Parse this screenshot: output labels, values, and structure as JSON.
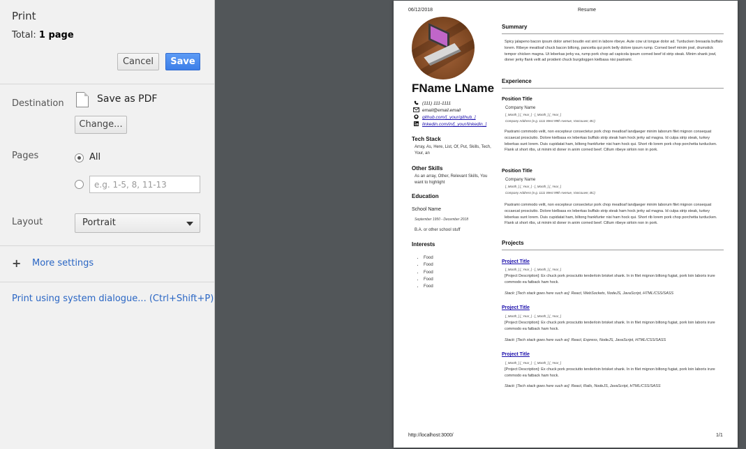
{
  "panel": {
    "title": "Print",
    "total_label": "Total:",
    "total_value": "1 page",
    "cancel": "Cancel",
    "save": "Save",
    "destination_label": "Destination",
    "destination_value": "Save as PDF",
    "change": "Change...",
    "pages_label": "Pages",
    "pages_all": "All",
    "pages_range_placeholder": "e.g. 1-5, 8, 11-13",
    "layout_label": "Layout",
    "layout_value": "Portrait",
    "more_settings": "More settings",
    "system_dialog": "Print using system dialogue... (Ctrl+Shift+P)"
  },
  "page": {
    "date": "06/12/2018",
    "header_title": "Resume",
    "footer_url": "http://localhost:3000/",
    "footer_page": "1/1",
    "name": "FName LName",
    "phone": "(111) 111-1111",
    "email": "email@email.email",
    "github": "github.com/[_your/github_]",
    "linkedin": "linkedin.com/in/[_your/linkedin_]",
    "tech_stack_h": "Tech Stack",
    "tech_stack": "Array, As, Here, List, Of, Put, Skills, Tech, Your, an",
    "other_skills_h": "Other Skills",
    "other_skills": "As an array, Other, Relevant Skills, You want to highlight",
    "education_h": "Education",
    "school": "School Name",
    "edu_dates": "September 1950 - December 2018",
    "degree": "B.A. or other school stuff",
    "interests_h": "Interests",
    "interests": [
      "Food",
      "Food",
      "Food",
      "Food",
      "Food"
    ],
    "summary_h": "Summary",
    "summary": "Spicy jalapeno bacon ipsum dolor amet boudin est sint in labore ribeye. Aute cow ut tongue dolor ad. Turducken bresaola buffalo lorem. Ribeye meatloaf chuck bacon biltong, pancetta qui pork belly dolore ipsum rump. Corned beef minim jowl, drumstick tempor chicken magna. Ut leberkas jerky ea, rump pork chop ad capicola ipsum corned beef id strip steak. Minim shank jowl, doner jerky flank velit ad proident chuck burgdoggen kielbasa nisi pastrami.",
    "experience_h": "Experience",
    "jobs": [
      {
        "title": "Position Title",
        "company": "Company Name",
        "dates": "[_Month_] [_Year_] - [_Month_] [_Year_]",
        "address": "Company Address (e.g. 1111 West 99th Avenue, Vancouver, BC)",
        "desc": "Pastrami commodo velit, non excepteur consectetur pork chop meatloaf landjaeger minim laborum filet mignon consequat occaecat prosciutto. Dolore kielbasa ex leberkas buffalo strip steak ham hock jerky ad magna. Id culpa strip steak, turkey leberkas sunt lorem. Duis cupidatat ham, biltong frankfurter nisi ham hock qui. Short rib lorem pork chop porchetta turducken. Flank ut short ribs, ut minim id doner in anim corned beef. Cillum ribeye sirloin non in pork."
      },
      {
        "title": "Position Title",
        "company": "Company Name",
        "dates": "[_Month_] [_Year_] - [_Month_] [_Year_]",
        "address": "Company Address (e.g. 1111 West 99th Avenue, Vancouver, BC)",
        "desc": "Pastrami commodo velit, non excepteur consectetur pork chop meatloaf landjaeger minim laborum filet mignon consequat occaecat prosciutto. Dolore kielbasa ex leberkas buffalo strip steak ham hock jerky ad magna. Id culpa strip steak, turkey leberkas sunt lorem. Duis cupidatat ham, biltong frankfurter nisi ham hock qui. Short rib lorem pork chop porchetta turducken. Flank ut short ribs, ut minim id doner in anim corned beef. Cillum ribeye sirloin non in pork."
      }
    ],
    "projects_h": "Projects",
    "projects": [
      {
        "title": "Project Title",
        "dates": "[_Month_] [_Year_] - [_Month_] [_Year_]",
        "desc": "[Project Description]: Ex chuck pork prosciutto tenderloin brisket shank. In in filet mignon biltong fugiat, pork loin laboris irure commodo ea fatback ham hock.",
        "stack": "Stack: [Tech stack goes here such as]: React, WebSockets, NodeJS, JavaScript, HTML/CSS/SASS"
      },
      {
        "title": "Project Title",
        "dates": "[_Month_] [_Year_] - [_Month_] [_Year_]",
        "desc": "[Project Description]: Ex chuck pork prosciutto tenderloin brisket shank. In in filet mignon biltong fugiat, pork loin laboris irure commodo ea fatback ham hock.",
        "stack": "Stack: [Tech stack goes here such as]: React, Express, NodeJS, JavaScript, HTML/CSS/SASS"
      },
      {
        "title": "Project Title",
        "dates": "[_Month_] [_Year_] - [_Month_] [_Year_]",
        "desc": "[Project Description]: Ex chuck pork prosciutto tenderloin brisket shank. In in filet mignon biltong fugiat, pork loin laboris irure commodo ea fatback ham hock.",
        "stack": "Stack: [Tech stack goes here such as]: React, Rails, NodeJS, JavaScript, HTML/CSS/SASS"
      }
    ]
  }
}
